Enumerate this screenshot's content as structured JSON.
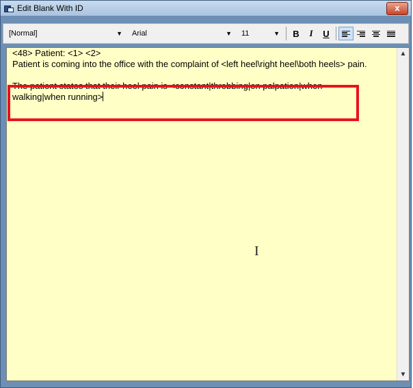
{
  "window": {
    "title": "Edit Blank With ID",
    "close_label": "x"
  },
  "toolbar": {
    "style_value": "[Normal]",
    "font_value": "Arial",
    "size_value": "11",
    "bold_label": "B",
    "italic_label": "I",
    "underline_label": "U",
    "active_alignment": "align-left"
  },
  "editor": {
    "lines": [
      "<48> Patient: <1> <2>",
      "Patient is coming into the office with the complaint of <left heel\\right heel\\both heels> pain.",
      "",
      "The patient states that their heel pain is <constant|throbbing|on palpation|when",
      "walking|when running>"
    ],
    "background": "#ffffc6"
  },
  "annotation": {
    "highlight_color": "#e8131c"
  },
  "icons": {
    "app": "app-icon",
    "close": "close-icon",
    "dropdown": "chevron-down-icon",
    "cursor": "ibeam-cursor-icon"
  }
}
